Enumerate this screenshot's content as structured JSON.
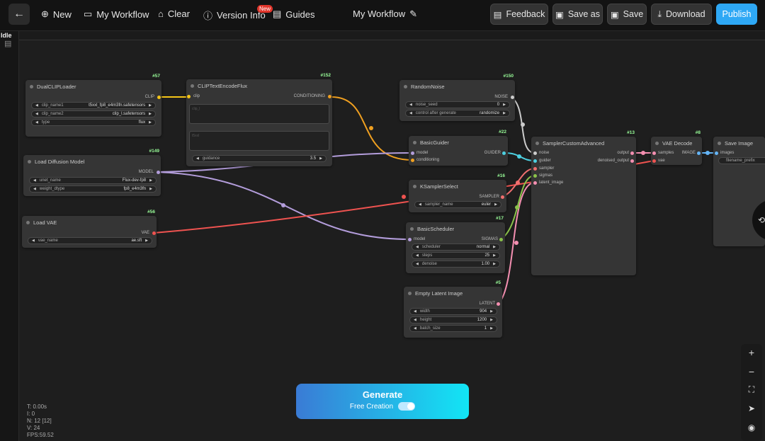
{
  "topbar": {
    "new": "New",
    "my_workflow": "My Workflow",
    "clear": "Clear",
    "version_info": "Version Info",
    "new_badge": "New",
    "guides": "Guides",
    "title": "My Workflow",
    "feedback": "Feedback",
    "save_as": "Save as",
    "save": "Save",
    "download": "Download",
    "publish": "Publish"
  },
  "status": {
    "idle": "Idle"
  },
  "nodes": {
    "dualclip": {
      "id": "#57",
      "title": "DualCLIPLoader",
      "out": "CLIP",
      "w1l": "clip_name1",
      "w1v": "t5xxl_fp8_e4m3fn.safetensors",
      "w2l": "clip_name2",
      "w2v": "clip_l.safetensors",
      "w3l": "type",
      "w3v": "flux"
    },
    "cliptext": {
      "id": "#152",
      "title": "CLIPTextEncodeFlux",
      "in": "clip",
      "out": "CONDITIONING",
      "t1": "clip_l",
      "t2": "t5xxl",
      "w1l": "guidance",
      "w1v": "3.5"
    },
    "loaddiff": {
      "id": "#149",
      "title": "Load Diffusion Model",
      "out": "MODEL",
      "w1l": "unet_name",
      "w1v": "Flux-dev-fp8",
      "w2l": "weight_dtype",
      "w2v": "fp8_e4m3fn"
    },
    "loadvae": {
      "id": "#56",
      "title": "Load VAE",
      "out": "VAE",
      "w1l": "vae_name",
      "w1v": "ae.sft"
    },
    "randnoise": {
      "id": "#150",
      "title": "RandomNoise",
      "out": "NOISE",
      "w1l": "noise_seed",
      "w1v": "0",
      "w2l": "control after generate",
      "w2v": "randomize"
    },
    "guider": {
      "id": "#22",
      "title": "BasicGuider",
      "in1": "model",
      "in2": "conditioning",
      "out": "GUIDER"
    },
    "ksel": {
      "id": "#16",
      "title": "KSamplerSelect",
      "out": "SAMPLER",
      "w1l": "sampler_name",
      "w1v": "euler"
    },
    "sched": {
      "id": "#17",
      "title": "BasicScheduler",
      "in": "model",
      "out": "SIGMAS",
      "w1l": "scheduler",
      "w1v": "normal",
      "w2l": "steps",
      "w2v": "25",
      "w3l": "denoise",
      "w3v": "1.00"
    },
    "latent": {
      "id": "#5",
      "title": "Empty Latent Image",
      "out": "LATENT",
      "w1l": "width",
      "w1v": "904",
      "w2l": "height",
      "w2v": "1200",
      "w3l": "batch_size",
      "w3v": "1"
    },
    "sampler": {
      "id": "#13",
      "title": "SamplerCustomAdvanced",
      "in1": "noise",
      "in2": "guider",
      "in3": "sampler",
      "in4": "sigmas",
      "in5": "latent_image",
      "out1": "output",
      "out2": "denoised_output"
    },
    "vaedec": {
      "id": "#8",
      "title": "VAE Decode",
      "in1": "samples",
      "in2": "vae",
      "out": "IMAGE"
    },
    "saveimg": {
      "title": "Save Image",
      "in": "images",
      "w1l": "filename_prefix"
    }
  },
  "generate": {
    "title": "Generate",
    "sub": "Free Creation",
    "toggle_on": true
  },
  "stats": {
    "t": "T: 0.00s",
    "i": "I: 0",
    "n": "N: 12 [12]",
    "v": "V: 24",
    "fps": "FPS:59.52"
  },
  "colors": {
    "clip": "#f5c518",
    "conditioning": "#f0a020",
    "model": "#b39ddb",
    "vae": "#ef5350",
    "latent": "#f48fb1",
    "noise": "#cccccc",
    "guider": "#4dd0e1",
    "sigmas": "#8bc34a",
    "image": "#64b5f6"
  }
}
